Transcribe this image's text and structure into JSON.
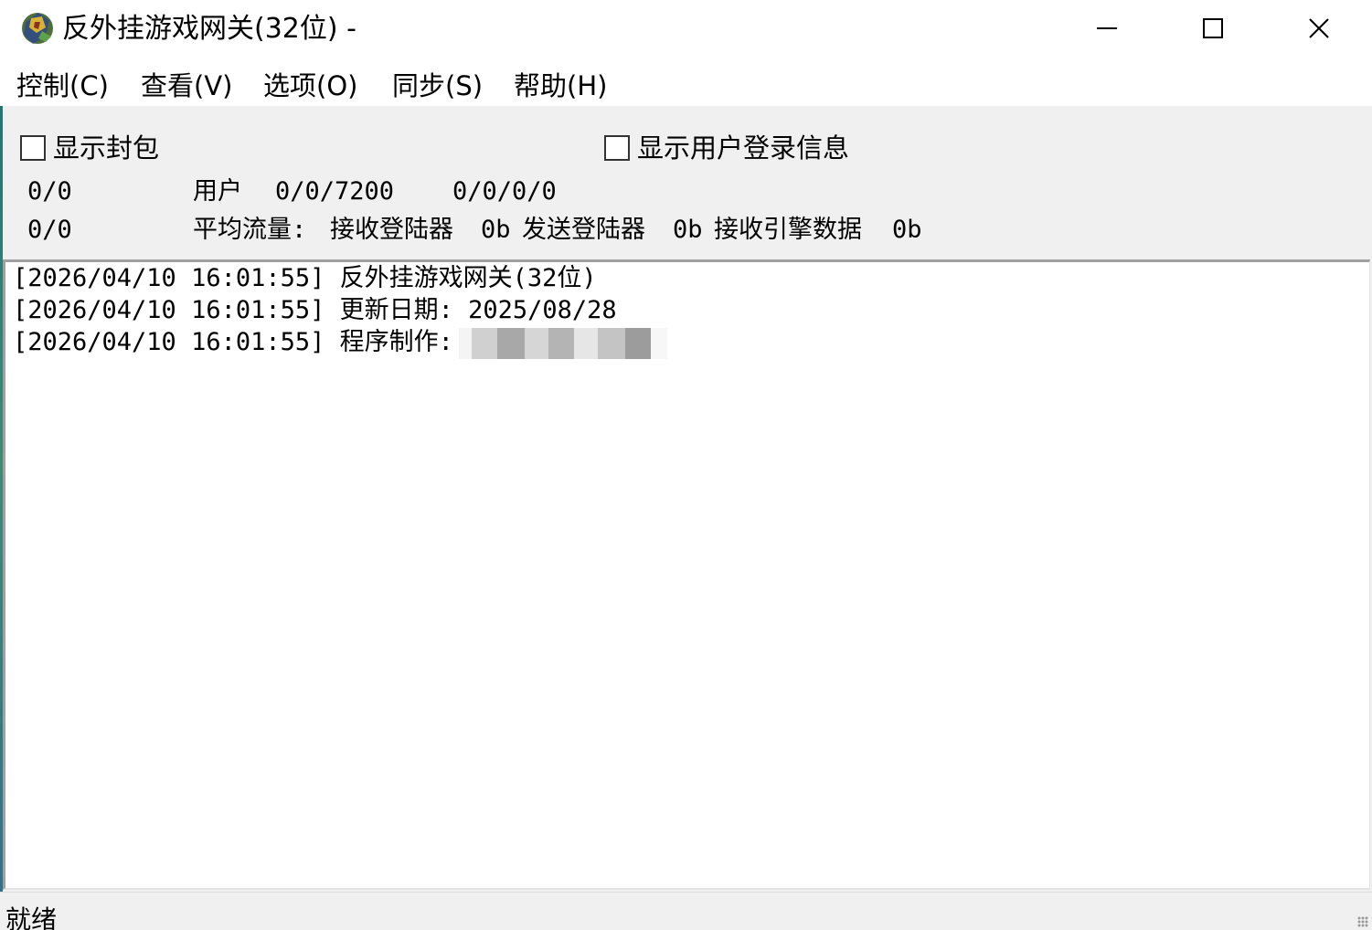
{
  "window": {
    "title": "反外挂游戏网关(32位) -",
    "controls": {
      "minimize": "minimize",
      "maximize": "maximize",
      "close": "close"
    }
  },
  "menu": {
    "items": [
      {
        "label": "控制(C)"
      },
      {
        "label": "查看(V)"
      },
      {
        "label": "选项(O)"
      },
      {
        "label": "同步(S)"
      },
      {
        "label": "帮助(H)"
      }
    ]
  },
  "options": {
    "show_packets": {
      "label": "显示封包",
      "checked": false
    },
    "show_login_info": {
      "label": "显示用户登录信息",
      "checked": false
    }
  },
  "stats": {
    "row1": {
      "left": "0/0",
      "user_label": "用户",
      "user_value": "0/0/7200",
      "extra": "0/0/0/0"
    },
    "row2": {
      "left": "0/0",
      "avg_label": "平均流量:",
      "recv_login_label": "接收登陆器",
      "recv_login_value": "0b",
      "send_login_label": "发送登陆器",
      "send_login_value": "0b",
      "recv_engine_label": "接收引擎数据",
      "recv_engine_value": "0b"
    }
  },
  "log": {
    "lines": [
      "[2026/04/10 16:01:55] 反外挂游戏网关(32位)",
      "[2026/04/10 16:01:55] 更新日期: 2025/08/28",
      "[2026/04/10 16:01:55] 程序制作:"
    ]
  },
  "status": {
    "text": "就绪"
  },
  "icons": {
    "app": "app-icon",
    "minimize": "minimize-icon",
    "maximize": "maximize-icon",
    "close": "close-icon"
  }
}
